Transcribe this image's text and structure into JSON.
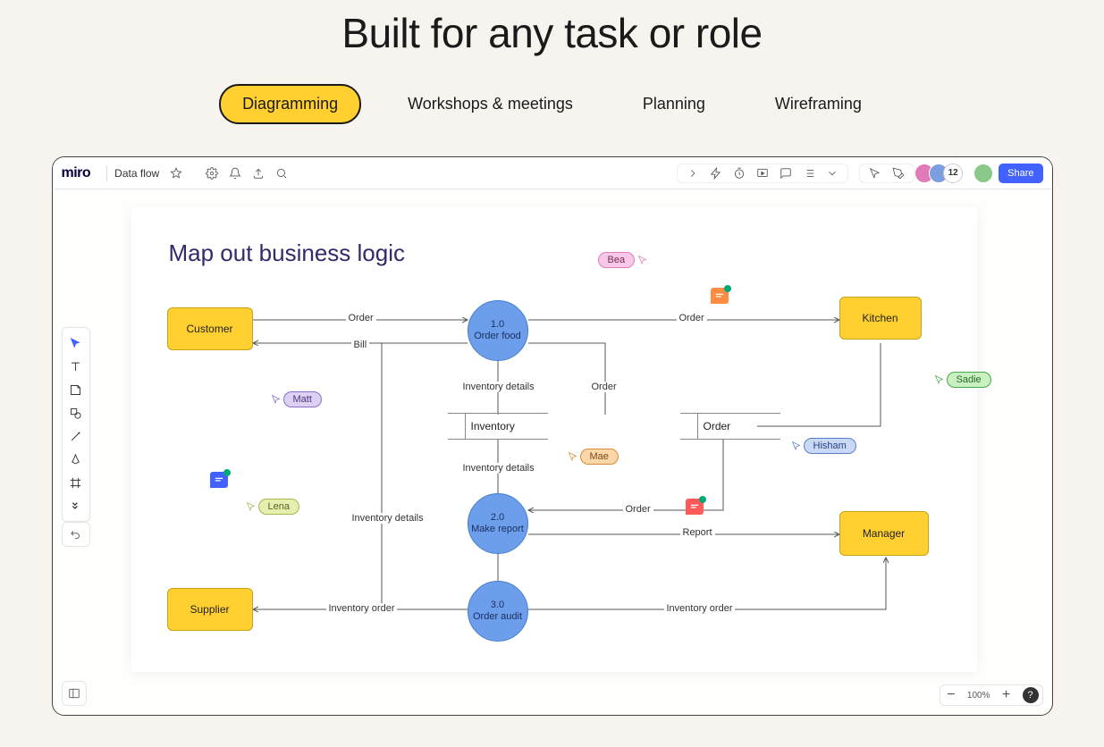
{
  "hero": {
    "title": "Built for any task or role",
    "tabs": [
      "Diagramming",
      "Workshops & meetings",
      "Planning",
      "Wireframing"
    ],
    "active_tab": 0
  },
  "topbar": {
    "logo": "miro",
    "board_name": "Data flow",
    "collaborator_count": "12",
    "share_label": "Share"
  },
  "canvas": {
    "title": "Map out business logic"
  },
  "nodes": {
    "customer": "Customer",
    "kitchen": "Kitchen",
    "supplier": "Supplier",
    "manager": "Manager",
    "order_food_num": "1.0",
    "order_food": "Order food",
    "make_report_num": "2.0",
    "make_report": "Make report",
    "order_audit_num": "3.0",
    "order_audit": "Order audit",
    "inventory": "Inventory",
    "order_store": "Order"
  },
  "edges": {
    "order": "Order",
    "bill": "Bill",
    "inventory_details": "Inventory details",
    "report": "Report",
    "inventory_order": "Inventory order"
  },
  "cursors": {
    "bea": "Bea",
    "matt": "Matt",
    "mae": "Mae",
    "lena": "Lena",
    "sadie": "Sadie",
    "hisham": "Hisham"
  },
  "bottom": {
    "zoom": "100%"
  },
  "colors": {
    "bea": "#f2a8db",
    "matt": "#c5b3e6",
    "mae": "#f5b77a",
    "lena": "#d6e27d",
    "sadie": "#a8e6a1",
    "hisham": "#a8c5f0",
    "comment_orange": "#ff8c42",
    "comment_red": "#ff5a5a",
    "comment_blue": "#4262ff"
  }
}
